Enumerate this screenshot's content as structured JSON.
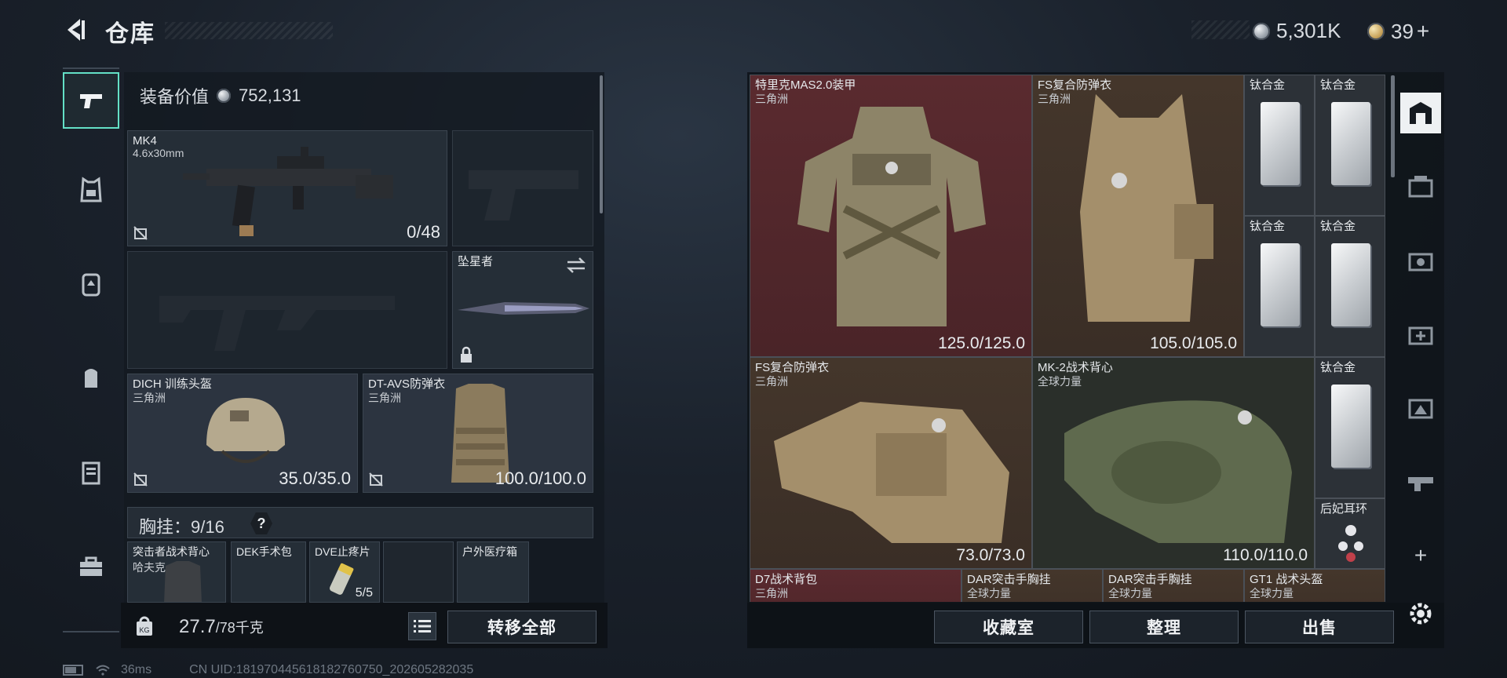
{
  "header": {
    "title": "仓库",
    "silver": "5,301K",
    "gold": "39",
    "gold_plus": "+"
  },
  "left_nav": [
    "pistol-icon",
    "vest-icon",
    "backpack-armor-icon",
    "bag-icon",
    "case-icon",
    "toolbox-icon"
  ],
  "loadout": {
    "equip_value_label": "装备价值",
    "equip_value": "752,131",
    "primary": {
      "name": "MK4",
      "caliber": "4.6x30mm",
      "ammo": "0/48"
    },
    "knife": {
      "name": "坠星者"
    },
    "helmet": {
      "name": "DICH 训练头盔",
      "map": "三角洲",
      "durability": "35.0/35.0"
    },
    "armor": {
      "name": "DT-AVS防弹衣",
      "map": "三角洲",
      "durability": "100.0/100.0"
    },
    "chest_rig_label": "胸挂：",
    "chest_rig_capacity": "9/16",
    "chest_rig_help": "?",
    "chest_items": [
      {
        "name": "突击者战术背心",
        "sub": "哈夫克"
      },
      {
        "name": "DEK手术包",
        "sub": ""
      },
      {
        "name": "DVE止疼片",
        "sub": "",
        "count": "5/5"
      },
      {
        "name": "",
        "sub": ""
      },
      {
        "name": "户外医疗箱",
        "sub": ""
      }
    ],
    "weight_current": "27.7",
    "weight_max": "/78千克",
    "transfer_all": "转移全部"
  },
  "storage": {
    "cells": [
      {
        "name": "特里克MAS2.0装甲",
        "sub": "三角洲",
        "value": "125.0/125.0"
      },
      {
        "name": "FS复合防弹衣",
        "sub": "三角洲",
        "value": "105.0/105.0"
      },
      {
        "name": "钛合金",
        "sub": "",
        "value": ""
      },
      {
        "name": "钛合金",
        "sub": "",
        "value": ""
      },
      {
        "name": "钛合金",
        "sub": "",
        "value": ""
      },
      {
        "name": "钛合金",
        "sub": "",
        "value": ""
      },
      {
        "name": "FS复合防弹衣",
        "sub": "三角洲",
        "value": "73.0/73.0"
      },
      {
        "name": "MK-2战术背心",
        "sub": "全球力量",
        "value": "110.0/110.0"
      },
      {
        "name": "钛合金",
        "sub": "",
        "value": ""
      },
      {
        "name": "后妃耳环",
        "sub": "",
        "value": ""
      },
      {
        "name": "D7战术背包",
        "sub": "三角洲",
        "value": ""
      },
      {
        "name": "DAR突击手胸挂",
        "sub": "全球力量",
        "value": ""
      },
      {
        "name": "DAR突击手胸挂",
        "sub": "全球力量",
        "value": ""
      },
      {
        "name": "GT1 战术头盔",
        "sub": "全球力量",
        "value": ""
      }
    ],
    "buttons": {
      "collection": "收藏室",
      "sort": "整理",
      "sell": "出售"
    },
    "side_plus": "+"
  },
  "footer": {
    "ping": "36ms",
    "uid": "CN UID:181970445618182760750_202605282035"
  },
  "colors": {
    "accent": "#63e0c6",
    "red_rarity": "#5a2a2f",
    "brown_rarity": "#44362b"
  }
}
